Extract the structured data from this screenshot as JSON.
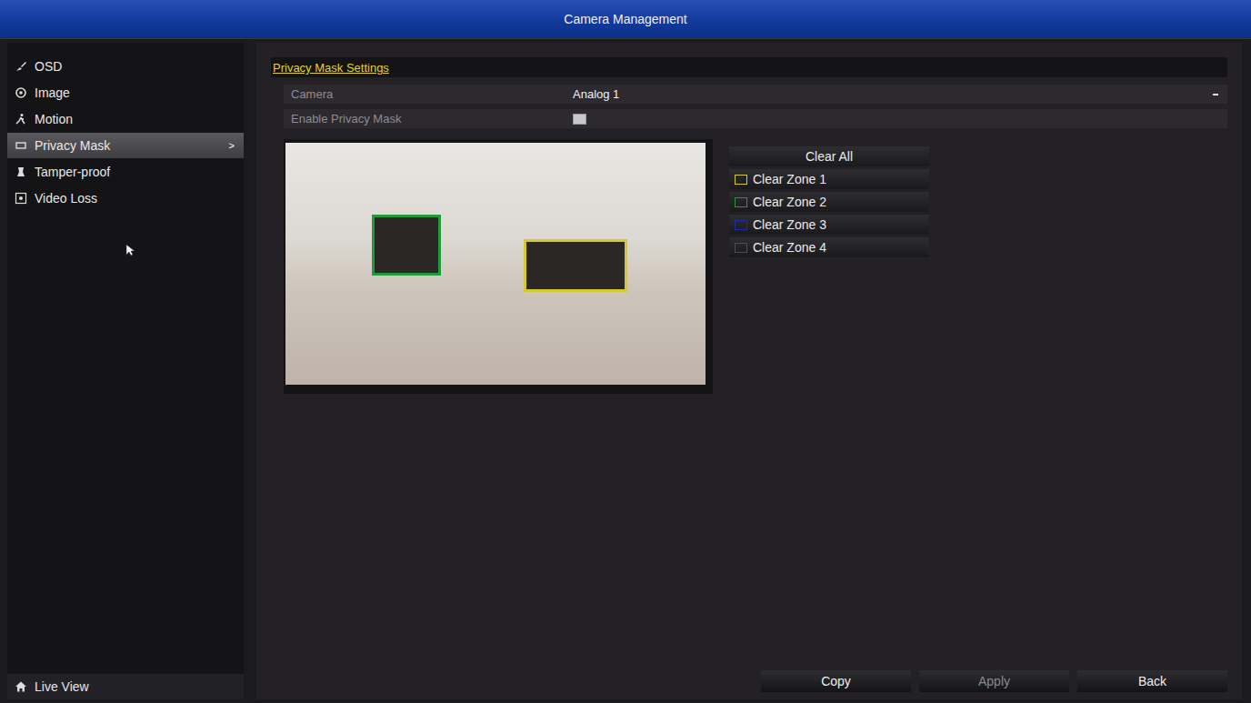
{
  "window": {
    "title": "Camera Management"
  },
  "sidebar": {
    "items": [
      {
        "label": "OSD",
        "selected": false,
        "icon": "osd"
      },
      {
        "label": "Image",
        "selected": false,
        "icon": "image"
      },
      {
        "label": "Motion",
        "selected": false,
        "icon": "motion"
      },
      {
        "label": "Privacy Mask",
        "selected": true,
        "icon": "mask"
      },
      {
        "label": "Tamper-proof",
        "selected": false,
        "icon": "tamper"
      },
      {
        "label": "Video Loss",
        "selected": false,
        "icon": "loss"
      }
    ],
    "selected_arrow": ">",
    "footer": {
      "label": "Live View"
    }
  },
  "settings": {
    "heading": "Privacy Mask Settings",
    "fields": [
      {
        "label": "Camera",
        "value": "Analog 1",
        "kind": "dropdown"
      },
      {
        "label": "Enable Privacy Mask",
        "kind": "checkbox",
        "checked": false
      }
    ]
  },
  "zones": {
    "clear_all": "Clear All",
    "items": [
      {
        "label": "Clear Zone 1",
        "color": "#d6c830",
        "masked": true
      },
      {
        "label": "Clear Zone 2",
        "color": "#1f9a3c",
        "masked": true
      },
      {
        "label": "Clear Zone 3",
        "color": "#1c2fa0",
        "masked": false
      },
      {
        "label": "Clear Zone 4",
        "color": "#5a4a3a",
        "masked": false
      }
    ]
  },
  "buttons": [
    {
      "label": "Copy",
      "disabled": false
    },
    {
      "label": "Apply",
      "disabled": true
    },
    {
      "label": "Back",
      "disabled": false
    }
  ]
}
